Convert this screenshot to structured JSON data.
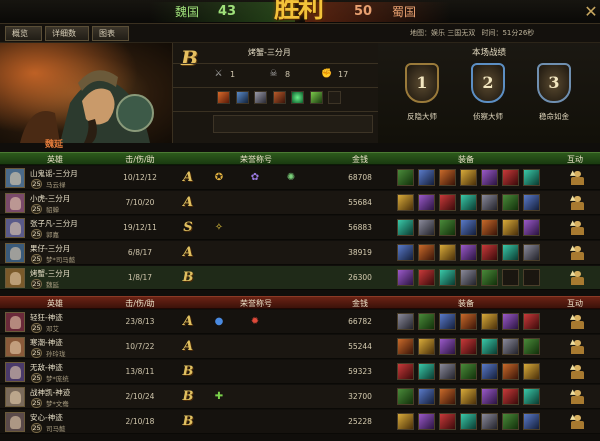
{
  "score": {
    "left_team": "魏国",
    "left_score": "43",
    "right_score": "50",
    "right_team": "蜀国",
    "result_text": "胜利"
  },
  "tabs": [
    "概览",
    "详细数据",
    "图表"
  ],
  "match_info": {
    "map": "地图：娱乐 三国无双",
    "time": "时间：51分26秒"
  },
  "hero": {
    "grade": "B",
    "name": "烤蟹-三分月",
    "kills": "1",
    "deaths": "8",
    "assists": "17"
  },
  "performance": {
    "title": "本场战绩",
    "medals": [
      {
        "number": "1",
        "label": "反隐大师"
      },
      {
        "number": "2",
        "label": "侦察大师"
      },
      {
        "number": "3",
        "label": "稳命如金"
      }
    ]
  },
  "teams": [
    {
      "banner": "魏延",
      "headers": [
        "英雄",
        "击/伤/助",
        "荣誉称号",
        "金钱",
        "装备",
        "互动"
      ],
      "players": [
        {
          "name": "山鬼谣-三分月",
          "id": "马云禄",
          "level": "25",
          "kda": "10/12/12",
          "grade": "A",
          "gold": "68708"
        },
        {
          "name": "小虎-三分月",
          "id": "貂蝉",
          "level": "25",
          "kda": "7/10/20",
          "grade": "A",
          "gold": "55684"
        },
        {
          "name": "张子凡-三分月",
          "id": "郭嘉",
          "level": "25",
          "kda": "19/12/11",
          "grade": "S",
          "gold": "56883"
        },
        {
          "name": "果仔-三分月",
          "id": "梦*司马懿",
          "level": "25",
          "kda": "6/8/17",
          "grade": "A",
          "gold": "38919"
        },
        {
          "name": "烤蟹-三分月",
          "id": "魏延",
          "level": "25",
          "kda": "1/8/17",
          "grade": "B",
          "gold": "26300"
        }
      ]
    },
    {
      "banner": "",
      "headers": [
        "英雄",
        "击/伤/助",
        "荣誉称号",
        "金钱",
        "装备",
        "互动"
      ],
      "players": [
        {
          "name": "轻狂-神迹",
          "id": "邓艾",
          "level": "25",
          "kda": "23/8/13",
          "grade": "A",
          "gold": "66782"
        },
        {
          "name": "寒潮-神迹",
          "id": "孙玲珑",
          "level": "25",
          "kda": "10/7/22",
          "grade": "A",
          "gold": "55244"
        },
        {
          "name": "无敌-神迹",
          "id": "梦*庞统",
          "level": "25",
          "kda": "13/8/11",
          "grade": "B",
          "gold": "59323"
        },
        {
          "name": "战神凯-神迹",
          "id": "梦*文鸯",
          "level": "25",
          "kda": "2/10/24",
          "grade": "B",
          "gold": "32700"
        },
        {
          "name": "安心-神迹",
          "id": "司马懿",
          "level": "25",
          "kda": "2/10/18",
          "grade": "B",
          "gold": "25228"
        }
      ]
    }
  ],
  "colors": {
    "wei": "#9fe07a",
    "shu": "#e8a070",
    "gold_accent": "#f3c23a"
  }
}
